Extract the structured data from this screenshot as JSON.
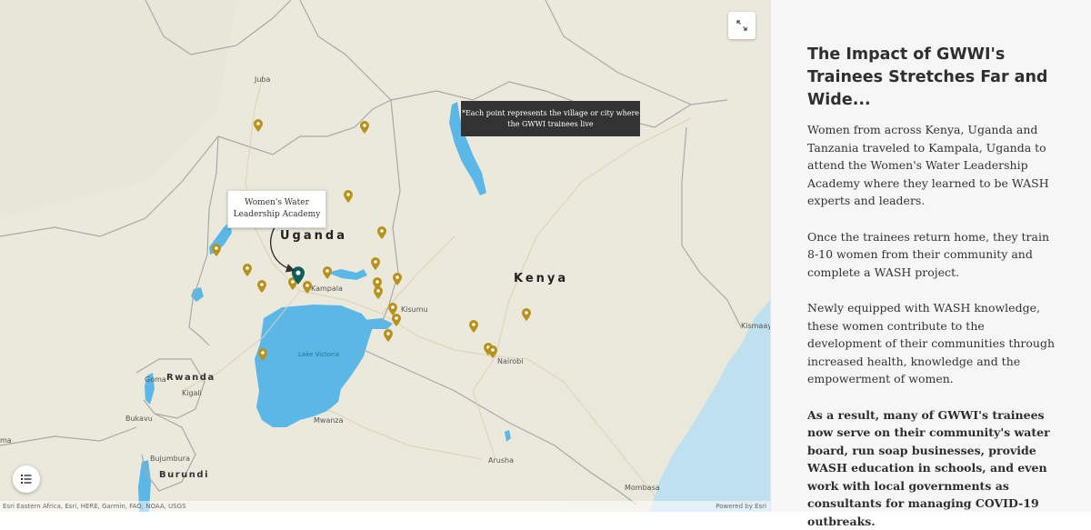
{
  "map": {
    "callout_text": "Women's Water Leadership Academy",
    "note_text": "*Each point represents the village or city where the GWWI trainees live",
    "countries": {
      "uganda": "Uganda",
      "kenya": "Kenya",
      "rwanda": "Rwanda",
      "burundi": "Burundi"
    },
    "cities": {
      "juba": "Juba",
      "kampala": "Kampala",
      "kisumu": "Kisumu",
      "nairobi": "Nairobi",
      "mwanza": "Mwanza",
      "kigali": "Kigali",
      "goma": "Goma",
      "bukavu": "Bukavu",
      "bujumbura": "Bujumbura",
      "arusha": "Arusha",
      "mombasa": "Mombasa",
      "kismaayo": "Kismaayo",
      "edge_ma": "ma"
    },
    "lake_label": "Lake Victoria",
    "attribution_left": "Esri Eastern Africa, Esri, HERE, Garmin, FAO, NOAA, USGS",
    "attribution_right": "Powered by Esri",
    "colors": {
      "water": "#5bb8e6",
      "pin": "#b8911c",
      "pin_highlight": "#0e5e5a",
      "land": "#ebe9dc"
    },
    "icons": {
      "fullscreen": "expand-icon",
      "legend": "list-icon"
    }
  },
  "panel": {
    "title": "The Impact of GWWI's Trainees Stretches Far and Wide...",
    "p1": "Women from across Kenya, Uganda and Tanzania traveled to Kampala, Uganda to attend the Women's Water Leadership Academy where they learned to be WASH experts and leaders.",
    "p2": "Once the trainees return home, they train 8-10 women from their community and complete a WASH project.",
    "p3": "Newly equipped with WASH knowledge, these women contribute to the development of their communities through increased health, knowledge and the empowerment of women.",
    "p4": "As a result, many of GWWI's trainees now serve on their community's water board, run soap businesses, provide WASH education in schools, and even work with local governments as consultants for managing COVID-19 outbreaks."
  }
}
